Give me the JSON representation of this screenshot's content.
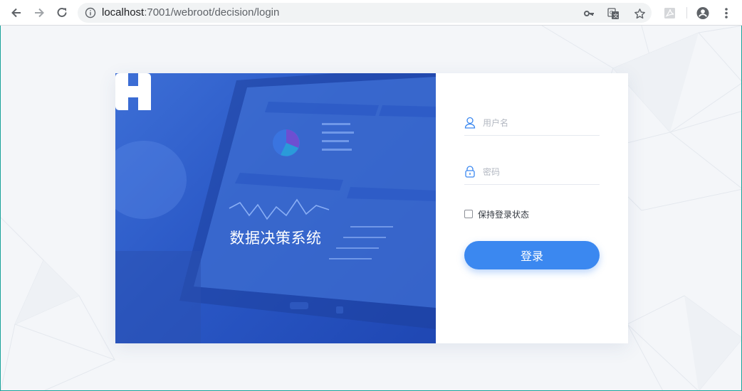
{
  "browser": {
    "url_host": "localhost",
    "url_rest": ":7001/webroot/decision/login",
    "icons": [
      "back-icon",
      "forward-icon",
      "reload-icon",
      "info-icon",
      "key-icon",
      "translate-icon",
      "star-icon",
      "pdf-extension-icon",
      "account-icon",
      "menu-icon"
    ]
  },
  "hero": {
    "title": "数据决策系统",
    "logo": "fr-logo"
  },
  "login": {
    "username_placeholder": "用户名",
    "password_placeholder": "密码",
    "remember_label": "保持登录状态",
    "remember_checked": false,
    "submit_label": "登录",
    "accent_color": "#3b88f0"
  }
}
